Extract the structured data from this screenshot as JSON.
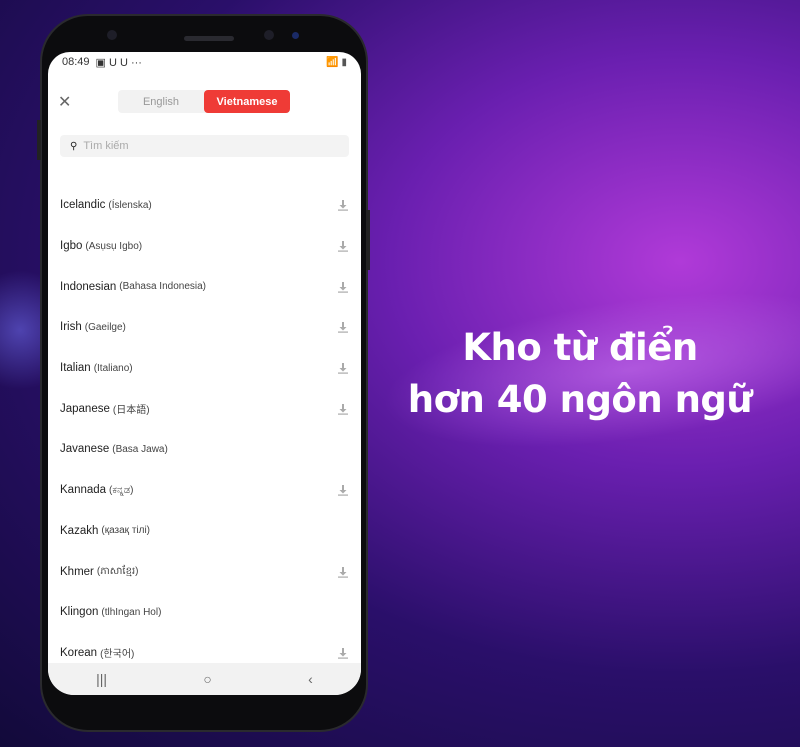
{
  "headline": {
    "line1": "Kho từ điển",
    "line2": "hơn 40 ngôn ngữ"
  },
  "status": {
    "time": "08:49",
    "icons": "▣ U U ···",
    "right": "📶 ▮"
  },
  "tabs": [
    {
      "label": "English",
      "active": false
    },
    {
      "label": "Vietnamese",
      "active": true
    }
  ],
  "accent": "#ef3b36",
  "search": {
    "placeholder": "Tìm kiếm"
  },
  "languages": [
    {
      "name": "Icelandic",
      "native": "(Íslenska)",
      "download": true
    },
    {
      "name": "Igbo",
      "native": "(Asụsụ Igbo)",
      "download": true
    },
    {
      "name": "Indonesian",
      "native": "(Bahasa Indonesia)",
      "download": true
    },
    {
      "name": "Irish",
      "native": "(Gaeilge)",
      "download": true
    },
    {
      "name": "Italian",
      "native": "(Italiano)",
      "download": true
    },
    {
      "name": "Japanese",
      "native": "(日本語)",
      "download": true
    },
    {
      "name": "Javanese",
      "native": "(Basa Jawa)",
      "download": false
    },
    {
      "name": "Kannada",
      "native": "(ಕನ್ನಡ)",
      "download": true
    },
    {
      "name": "Kazakh",
      "native": "(қазақ тілі)",
      "download": false
    },
    {
      "name": "Khmer",
      "native": "(ភាសាខ្មែរ)",
      "download": true
    },
    {
      "name": "Klingon",
      "native": "(tlhIngan Hol)",
      "download": false
    },
    {
      "name": "Korean",
      "native": "(한국어)",
      "download": true
    }
  ],
  "nav": {
    "recent": "|||",
    "home": "○",
    "back": "‹"
  }
}
